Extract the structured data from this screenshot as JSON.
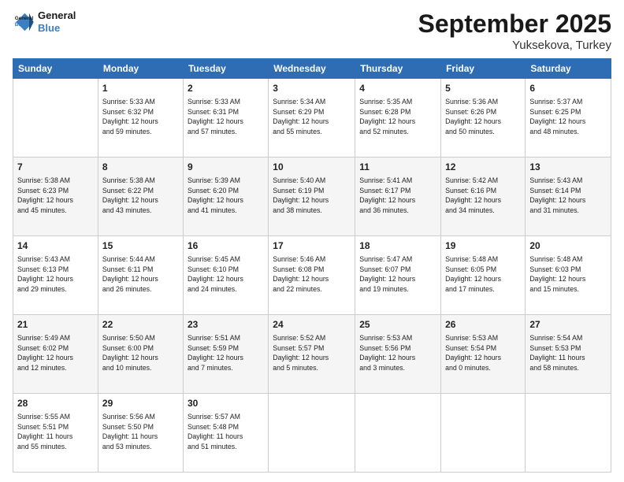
{
  "logo": {
    "line1": "General",
    "line2": "Blue"
  },
  "title": "September 2025",
  "subtitle": "Yuksekova, Turkey",
  "days_of_week": [
    "Sunday",
    "Monday",
    "Tuesday",
    "Wednesday",
    "Thursday",
    "Friday",
    "Saturday"
  ],
  "weeks": [
    [
      {
        "day": "",
        "info": ""
      },
      {
        "day": "1",
        "info": "Sunrise: 5:33 AM\nSunset: 6:32 PM\nDaylight: 12 hours\nand 59 minutes."
      },
      {
        "day": "2",
        "info": "Sunrise: 5:33 AM\nSunset: 6:31 PM\nDaylight: 12 hours\nand 57 minutes."
      },
      {
        "day": "3",
        "info": "Sunrise: 5:34 AM\nSunset: 6:29 PM\nDaylight: 12 hours\nand 55 minutes."
      },
      {
        "day": "4",
        "info": "Sunrise: 5:35 AM\nSunset: 6:28 PM\nDaylight: 12 hours\nand 52 minutes."
      },
      {
        "day": "5",
        "info": "Sunrise: 5:36 AM\nSunset: 6:26 PM\nDaylight: 12 hours\nand 50 minutes."
      },
      {
        "day": "6",
        "info": "Sunrise: 5:37 AM\nSunset: 6:25 PM\nDaylight: 12 hours\nand 48 minutes."
      }
    ],
    [
      {
        "day": "7",
        "info": "Sunrise: 5:38 AM\nSunset: 6:23 PM\nDaylight: 12 hours\nand 45 minutes."
      },
      {
        "day": "8",
        "info": "Sunrise: 5:38 AM\nSunset: 6:22 PM\nDaylight: 12 hours\nand 43 minutes."
      },
      {
        "day": "9",
        "info": "Sunrise: 5:39 AM\nSunset: 6:20 PM\nDaylight: 12 hours\nand 41 minutes."
      },
      {
        "day": "10",
        "info": "Sunrise: 5:40 AM\nSunset: 6:19 PM\nDaylight: 12 hours\nand 38 minutes."
      },
      {
        "day": "11",
        "info": "Sunrise: 5:41 AM\nSunset: 6:17 PM\nDaylight: 12 hours\nand 36 minutes."
      },
      {
        "day": "12",
        "info": "Sunrise: 5:42 AM\nSunset: 6:16 PM\nDaylight: 12 hours\nand 34 minutes."
      },
      {
        "day": "13",
        "info": "Sunrise: 5:43 AM\nSunset: 6:14 PM\nDaylight: 12 hours\nand 31 minutes."
      }
    ],
    [
      {
        "day": "14",
        "info": "Sunrise: 5:43 AM\nSunset: 6:13 PM\nDaylight: 12 hours\nand 29 minutes."
      },
      {
        "day": "15",
        "info": "Sunrise: 5:44 AM\nSunset: 6:11 PM\nDaylight: 12 hours\nand 26 minutes."
      },
      {
        "day": "16",
        "info": "Sunrise: 5:45 AM\nSunset: 6:10 PM\nDaylight: 12 hours\nand 24 minutes."
      },
      {
        "day": "17",
        "info": "Sunrise: 5:46 AM\nSunset: 6:08 PM\nDaylight: 12 hours\nand 22 minutes."
      },
      {
        "day": "18",
        "info": "Sunrise: 5:47 AM\nSunset: 6:07 PM\nDaylight: 12 hours\nand 19 minutes."
      },
      {
        "day": "19",
        "info": "Sunrise: 5:48 AM\nSunset: 6:05 PM\nDaylight: 12 hours\nand 17 minutes."
      },
      {
        "day": "20",
        "info": "Sunrise: 5:48 AM\nSunset: 6:03 PM\nDaylight: 12 hours\nand 15 minutes."
      }
    ],
    [
      {
        "day": "21",
        "info": "Sunrise: 5:49 AM\nSunset: 6:02 PM\nDaylight: 12 hours\nand 12 minutes."
      },
      {
        "day": "22",
        "info": "Sunrise: 5:50 AM\nSunset: 6:00 PM\nDaylight: 12 hours\nand 10 minutes."
      },
      {
        "day": "23",
        "info": "Sunrise: 5:51 AM\nSunset: 5:59 PM\nDaylight: 12 hours\nand 7 minutes."
      },
      {
        "day": "24",
        "info": "Sunrise: 5:52 AM\nSunset: 5:57 PM\nDaylight: 12 hours\nand 5 minutes."
      },
      {
        "day": "25",
        "info": "Sunrise: 5:53 AM\nSunset: 5:56 PM\nDaylight: 12 hours\nand 3 minutes."
      },
      {
        "day": "26",
        "info": "Sunrise: 5:53 AM\nSunset: 5:54 PM\nDaylight: 12 hours\nand 0 minutes."
      },
      {
        "day": "27",
        "info": "Sunrise: 5:54 AM\nSunset: 5:53 PM\nDaylight: 11 hours\nand 58 minutes."
      }
    ],
    [
      {
        "day": "28",
        "info": "Sunrise: 5:55 AM\nSunset: 5:51 PM\nDaylight: 11 hours\nand 55 minutes."
      },
      {
        "day": "29",
        "info": "Sunrise: 5:56 AM\nSunset: 5:50 PM\nDaylight: 11 hours\nand 53 minutes."
      },
      {
        "day": "30",
        "info": "Sunrise: 5:57 AM\nSunset: 5:48 PM\nDaylight: 11 hours\nand 51 minutes."
      },
      {
        "day": "",
        "info": ""
      },
      {
        "day": "",
        "info": ""
      },
      {
        "day": "",
        "info": ""
      },
      {
        "day": "",
        "info": ""
      }
    ]
  ]
}
